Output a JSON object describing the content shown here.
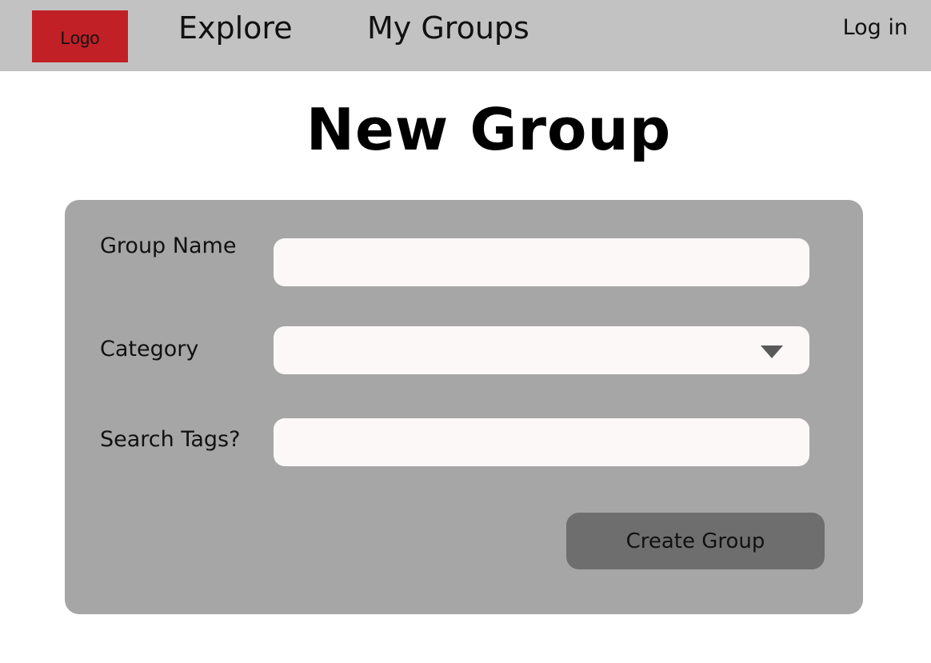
{
  "nav": {
    "logo": "Logo",
    "links": [
      "Explore",
      "My Groups"
    ],
    "login": "Log in"
  },
  "page": {
    "title": "New Group"
  },
  "form": {
    "group_name_label": "Group Name",
    "group_name_value": "",
    "category_label": "Category",
    "category_value": "",
    "tags_label": "Search Tags?",
    "tags_value": "",
    "submit_label": "Create Group"
  },
  "colors": {
    "logo_bg": "#c12126",
    "navbar_bg": "#c2c2c2",
    "panel_bg": "#a6a6a6",
    "input_bg": "#fcf8f8",
    "button_bg": "#6e6e6e"
  },
  "icons": {
    "category_dropdown": "chevron-down-icon"
  }
}
